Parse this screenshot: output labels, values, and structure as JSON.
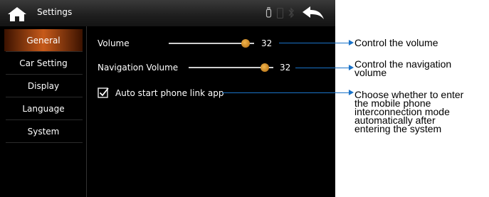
{
  "header": {
    "title": "Settings",
    "home_icon": "home-icon",
    "back_icon": "back-arrow-icon",
    "status_icons": [
      "usb-icon",
      "phone-icon",
      "bluetooth-icon"
    ]
  },
  "sidebar": {
    "items": [
      {
        "label": "General",
        "active": true
      },
      {
        "label": "Car Setting",
        "active": false
      },
      {
        "label": "Display",
        "active": false
      },
      {
        "label": "Language",
        "active": false
      },
      {
        "label": "System",
        "active": false
      }
    ]
  },
  "settings": {
    "volume": {
      "label": "Volume",
      "value": "32",
      "level": 0.9
    },
    "navigation_volume": {
      "label": "Navigation Volume",
      "value": "32",
      "level": 0.9
    },
    "auto_start": {
      "label": "Auto start phone link app",
      "checked": true
    }
  },
  "annotations": {
    "volume": "Control the volume",
    "navigation_volume": "Control the navigation\nvolume",
    "auto_start": "Choose whether to enter\nthe mobile phone\ninterconnection mode\nautomatically after\nentering the system"
  },
  "colors": {
    "accent": "#c75a1a",
    "knob": "#d8902a",
    "callout": "#1a73c9"
  }
}
